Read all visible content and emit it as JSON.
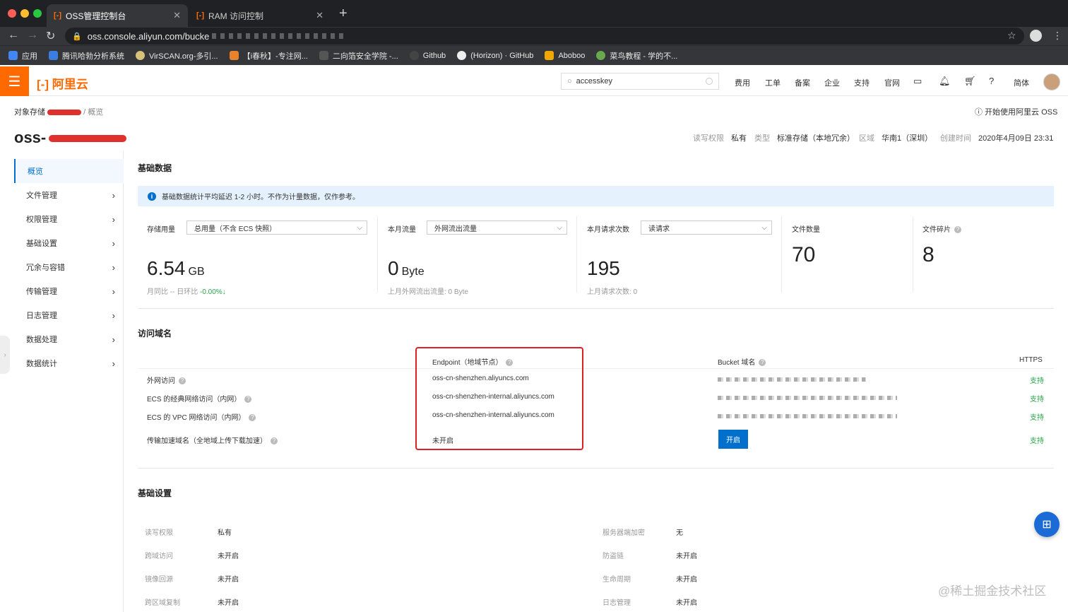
{
  "browser": {
    "tabs": [
      {
        "title": "OSS管理控制台",
        "active": true
      },
      {
        "title": "RAM 访问控制",
        "active": false
      }
    ],
    "url_host": "oss.console.aliyun.com/bucke",
    "bookmarks": [
      "应用",
      "腾讯哈勃分析系统",
      "VirSCAN.org-多引...",
      "【i春秋】-专注网...",
      "二向箔安全学院 -...",
      "Github",
      "(Horizon) · GitHub",
      "Aboboo",
      "菜鸟教程 - 学的不..."
    ]
  },
  "header": {
    "logo": "阿里云",
    "search_value": "accesskey",
    "nav": [
      "费用",
      "工单",
      "备案",
      "企业",
      "支持",
      "官网"
    ],
    "lang": "简体"
  },
  "breadcrumb": {
    "root": "对象存储",
    "sep": "/",
    "current": "概览"
  },
  "start_link": "开始使用阿里云 OSS",
  "bucket": {
    "name": "oss-",
    "meta": [
      {
        "k": "读写权限",
        "v": "私有"
      },
      {
        "k": "类型",
        "v": "标准存储（本地冗余）"
      },
      {
        "k": "区域",
        "v": "华南1（深圳）"
      },
      {
        "k": "创建时间",
        "v": "2020年4月09日 23:31"
      }
    ]
  },
  "sidebar": {
    "items": [
      {
        "label": "概览",
        "active": true
      },
      {
        "label": "文件管理"
      },
      {
        "label": "权限管理"
      },
      {
        "label": "基础设置"
      },
      {
        "label": "冗余与容错"
      },
      {
        "label": "传输管理"
      },
      {
        "label": "日志管理"
      },
      {
        "label": "数据处理"
      },
      {
        "label": "数据统计"
      }
    ]
  },
  "basic_data": {
    "title": "基础数据",
    "notice": "基础数据统计平均延迟 1-2 小时。不作为计量数据，仅作参考。",
    "storage": {
      "label": "存储用量",
      "select": "总用量（不含 ECS 快照）",
      "value": "6.54",
      "unit": "GB",
      "sub_prefix": "月同比 --  日环比",
      "sub_change": "-0.00%↓"
    },
    "traffic": {
      "label": "本月流量",
      "select": "外网流出流量",
      "value": "0",
      "unit": "Byte",
      "sub": "上月外网流出流量:  0 Byte"
    },
    "requests": {
      "label": "本月请求次数",
      "select": "读请求",
      "value": "195",
      "sub": "上月请求次数:    0"
    },
    "files": {
      "label": "文件数量",
      "value": "70"
    },
    "fragments": {
      "label": "文件碎片",
      "value": "8"
    }
  },
  "domains": {
    "title": "访问域名",
    "headers": {
      "endpoint": "Endpoint（地域节点）",
      "bucket": "Bucket 域名",
      "https": "HTTPS"
    },
    "rows": [
      {
        "name": "外网访问",
        "endpoint": "oss-cn-shenzhen.aliyuncs.com",
        "https": "支持"
      },
      {
        "name": "ECS 的经典网络访问（内网）",
        "endpoint": "oss-cn-shenzhen-internal.aliyuncs.com",
        "https": "支持"
      },
      {
        "name": "ECS 的 VPC 网络访问（内网）",
        "endpoint": "oss-cn-shenzhen-internal.aliyuncs.com",
        "https": "支持"
      },
      {
        "name": "传输加速域名（全地域上传下载加速）",
        "endpoint": "未开启",
        "https": "支持"
      }
    ],
    "open_button": "开启"
  },
  "settings": {
    "title": "基础设置",
    "left": [
      {
        "k": "读写权限",
        "v": "私有"
      },
      {
        "k": "跨域访问",
        "v": "未开启"
      },
      {
        "k": "镜像回源",
        "v": "未开启"
      },
      {
        "k": "跨区域复制",
        "v": "未开启"
      }
    ],
    "right": [
      {
        "k": "服务器端加密",
        "v": "无"
      },
      {
        "k": "防盗链",
        "v": "未开启"
      },
      {
        "k": "生命周期",
        "v": "未开启"
      },
      {
        "k": "日志管理",
        "v": "未开启"
      }
    ]
  },
  "watermark": "@稀土掘金技术社区",
  "colors": {
    "brand": "#ff6a00",
    "primary": "#0070cc",
    "success": "#2aa34a",
    "highlight": "#e02020"
  }
}
